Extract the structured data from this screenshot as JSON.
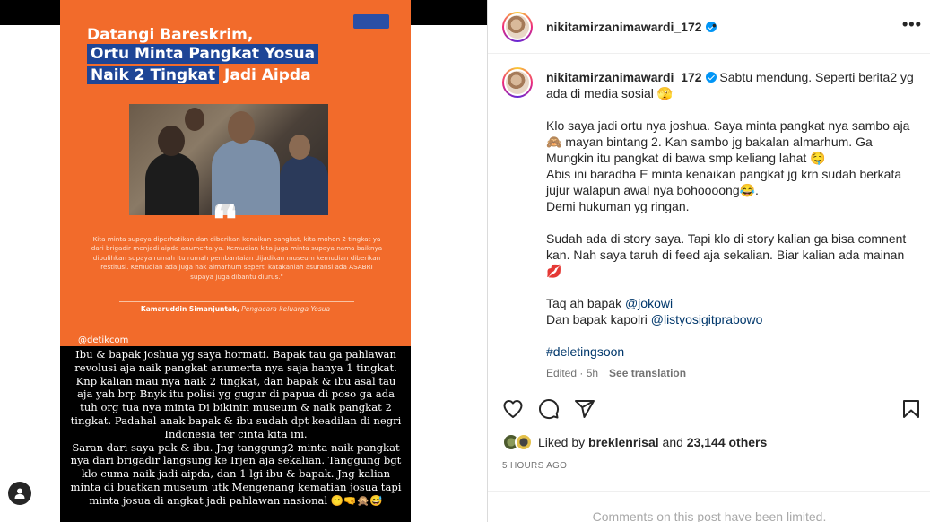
{
  "post": {
    "username": "nikitamirzanimawardi_172",
    "verified": true,
    "separator": "•",
    "more_glyph": "•••"
  },
  "media": {
    "headline": {
      "line1": "Datangi Bareskrim,",
      "line2": "Ortu Minta Pangkat Yosua",
      "line3_boxed": "Naik 2 Tingkat",
      "line3_rest": "Jadi Aipda"
    },
    "quote_mark": "❛❛",
    "quote_text": "Kita minta supaya diperhatikan dan diberikan kenaikan pangkat, kita mohon 2 tingkat ya dari brigadir menjadi aipda anumerta ya. Kemudian kita juga minta supaya nama baiknya dipulihkan supaya rumah itu rumah pembantaian dijadikan museum kemudian diberikan restitusi. Kemudian ada juga hak almarhum seperti katakanlah asuransi ada ASABRI supaya juga dibantu diurus.\"",
    "quote_author": "Kamaruddin Simanjuntak,",
    "quote_author_role": "Pengacara keluarga Yosua",
    "source": "@detikcom",
    "story_paragraphs": [
      "Ibu & bapak joshua yg saya hormati. Bapak tau ga pahlawan revolusi aja naik pangkat anumerta nya saja hanya 1 tingkat. Knp kalian mau nya naik 2 tingkat, dan bapak & ibu asal tau aja yah brp Bnyk itu polisi yg gugur di papua di poso ga ada tuh org tua nya minta Di bikinin museum & naik pangkat 2 tingkat. Padahal anak bapak & ibu sudah dpt keadilan di negri Indonesia ter cinta kita ini.",
      "Saran dari saya pak & ibu. Jng tanggung2 minta naik pangkat nya dari brigadir langsung ke Irjen aja sekalian. Tanggung bgt klo cuma naik jadi aipda, dan 1 lgi ibu & bapak. Jng kalian minta di buatkan museum utk Mengenang kematian josua tapi minta josua di angkat jadi pahlawan nasional 😶🤜🙊😅"
    ]
  },
  "caption": {
    "lines": [
      "Sabtu mendung. Seperti berita2 yg ada di media sosial 🫣",
      "",
      "Klo saya jadi ortu nya joshua. Saya minta pangkat nya sambo aja 🙈 mayan bintang 2. Kan sambo jg bakalan almarhum. Ga Mungkin itu pangkat di bawa smp keliang lahat 🤤",
      "Abis ini baradha E minta kenaikan pangkat jg krn sudah berkata jujur walapun awal nya bohoooong😂.",
      "Demi hukuman yg ringan.",
      "",
      "Sudah ada di story saya. Tapi klo di story kalian ga bisa comnent kan. Nah saya taruh di feed aja sekalian. Biar kalian ada mainan 💋",
      ""
    ],
    "mention1_prefix": "Taq ah bapak ",
    "mention1": "@jokowi",
    "mention2_prefix": "Dan bapak kapolri ",
    "mention2": "@listyosigitprabowo",
    "hashtag": "#deletingsoon",
    "edited": "Edited · 5h",
    "see_translation": "See translation"
  },
  "actions": {
    "like_icon": "heart-icon",
    "comment_icon": "comment-icon",
    "share_icon": "share-icon",
    "save_icon": "bookmark-icon"
  },
  "likes": {
    "prefix": "Liked by ",
    "user": "breklenrisal",
    "middle": " and ",
    "others": "23,144 others"
  },
  "time_ago": "5 HOURS AGO",
  "comments_limited": "Comments on this post have been limited."
}
